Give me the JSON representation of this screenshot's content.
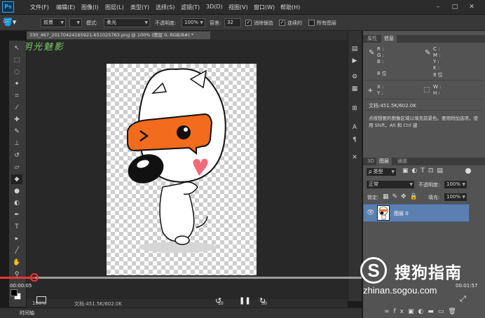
{
  "app": {
    "logo": "Ps"
  },
  "menu": [
    "文件(F)",
    "编辑(E)",
    "图像(I)",
    "图层(L)",
    "类型(Y)",
    "选择(S)",
    "滤镜(T)",
    "3D(D)",
    "视图(V)",
    "窗口(W)",
    "帮助(H)"
  ],
  "options": {
    "preset": "前景",
    "mode_label": "模式:",
    "mode_value": "柔光",
    "opacity_label": "不透明度:",
    "opacity_value": "100%",
    "tolerance_label": "容差:",
    "tolerance_value": "32",
    "antialias_label": "消除锯齿",
    "contiguous_label": "连续的",
    "alllayers_label": "所有图层"
  },
  "document": {
    "tab_title": "330_467_20170424165921-651025763.png @ 100% (图层 0, RGB/8#) *",
    "watermark": "明光魅影",
    "zoom": "100%",
    "doc_info": "文档:451.5K/602.0K"
  },
  "info_panel": {
    "tabs": [
      "属性",
      "信息"
    ],
    "rgb_labels": [
      "R :",
      "G :",
      "B :"
    ],
    "cmyk_labels": [
      "C :",
      "M :",
      "Y :",
      "K :"
    ],
    "bit_left": "8 位",
    "bit_right": "8 位",
    "xy_labels": [
      "X :",
      "Y :"
    ],
    "wh_labels": [
      "W :",
      "H :"
    ],
    "doc_info": "文档:451.5K/602.0K",
    "hint": "点按想要的图像区域以填充前景色。要用附加选项，使用 Shift、Alt 和 Ctrl 键"
  },
  "layers_panel": {
    "tabs": [
      "3D",
      "图层",
      "通道"
    ],
    "kind_label": "ρ 类型",
    "blend_mode": "正常",
    "opacity_label": "不透明度:",
    "opacity_value": "100%",
    "lock_label": "锁定:",
    "fill_label": "填充:",
    "fill_value": "100%",
    "layer_name": "图层 0"
  },
  "video": {
    "current_time": "00:00:05",
    "total_time": "00:01:57",
    "rewind_label": "10",
    "forward_label": "30"
  },
  "bottom": {
    "timeline_label": "时间轴",
    "zoom": "100%",
    "doc_info": "文档:451.5K/602.0K"
  },
  "sogou": {
    "logo_letter": "S",
    "name": "搜狗指南",
    "url": "zhinan.sogou.com"
  }
}
